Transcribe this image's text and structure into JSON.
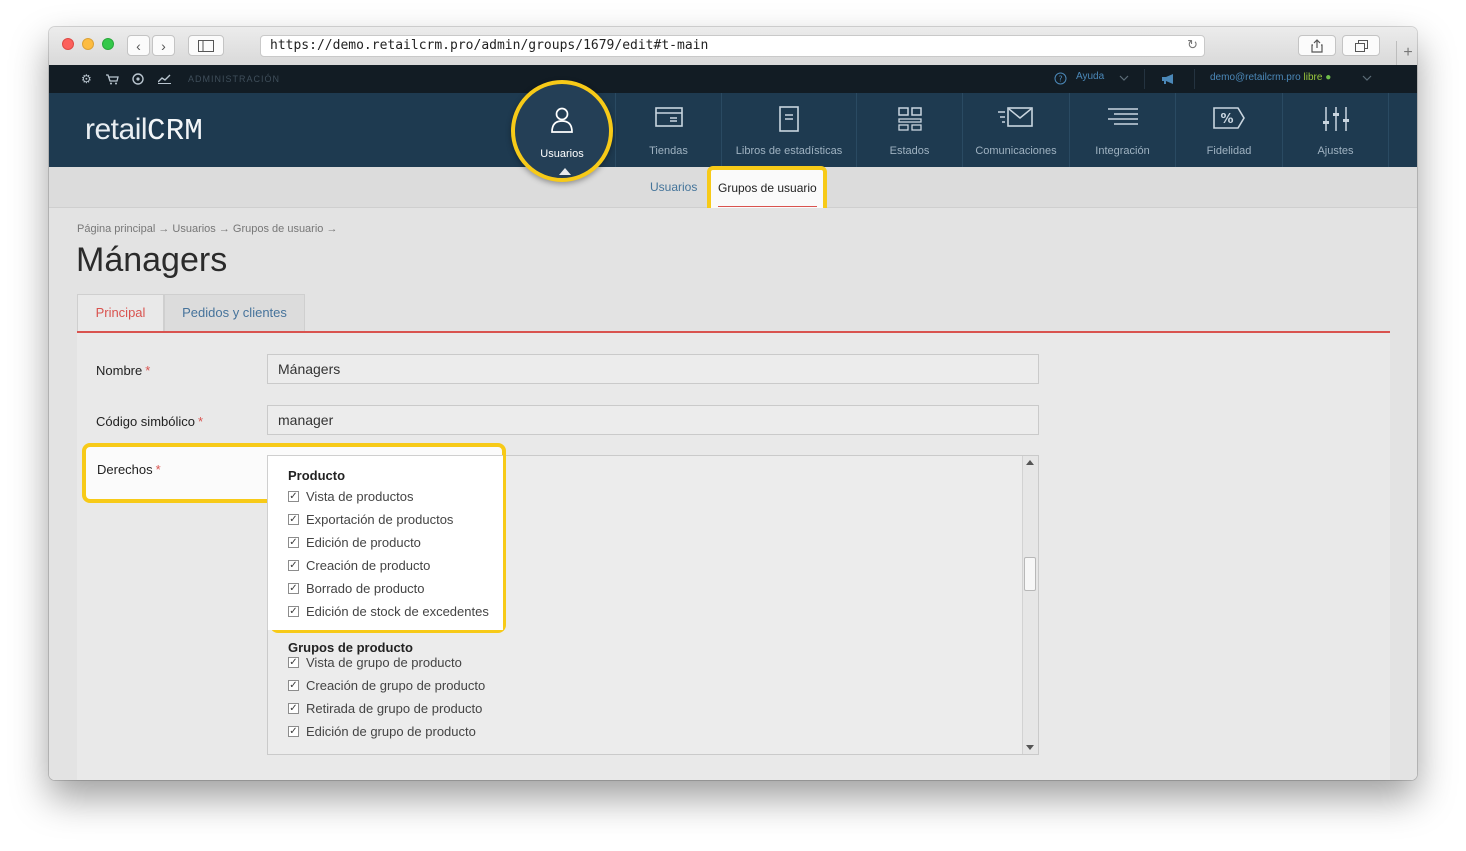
{
  "browser": {
    "url": "https://demo.retailcrm.pro/admin/groups/1679/edit#t-main",
    "reload_glyph": "↻",
    "back_glyph": "‹",
    "forward_glyph": "›",
    "new_tab_glyph": "+"
  },
  "admin_strip": {
    "label": "ADMINISTRACIÓN",
    "help": "Ayuda",
    "user_email": "demo@retailcrm.pro",
    "plan": "libre",
    "status_dot": "●"
  },
  "logo": {
    "prefix": "retail",
    "suffix": "CRM"
  },
  "nav": {
    "active": "Usuarios",
    "items": [
      "Tiendas",
      "Libros de estadísticas",
      "Estados",
      "Comunicaciones",
      "Integración",
      "Fidelidad",
      "Ajustes"
    ]
  },
  "subnav": {
    "items": [
      "Usuarios",
      "Grupos de usuario"
    ]
  },
  "breadcrumb": "Página principal → Usuarios → Grupos de usuario →",
  "page_title": "Mánagers",
  "tabs": [
    "Principal",
    "Pedidos y clientes"
  ],
  "form": {
    "name_label": "Nombre",
    "name_value": "Mánagers",
    "code_label": "Código simbólico",
    "code_value": "manager",
    "rights_label": "Derechos",
    "required_mark": "*"
  },
  "rights": {
    "groups": [
      {
        "title": "Producto",
        "items": [
          "Vista de productos",
          "Exportación de productos",
          "Edición de producto",
          "Creación de producto",
          "Borrado de producto",
          "Edición de stock de excedentes"
        ]
      },
      {
        "title": "Grupos de producto",
        "items": [
          "Vista de grupo de producto",
          "Creación de grupo de producto",
          "Retirada de grupo de producto",
          "Edición de grupo de producto"
        ]
      }
    ],
    "check_glyph": "✓"
  },
  "colors": {
    "highlight": "#f7ca18",
    "nav_bg": "#1e3a50",
    "accent_red": "#d9534f",
    "link_blue": "#44749a"
  }
}
